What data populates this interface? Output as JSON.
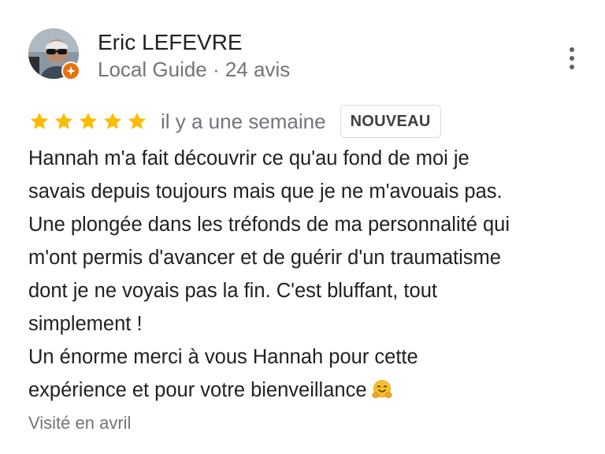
{
  "reviewer": {
    "name": "Eric LEFEVRE",
    "subtitle": "Local Guide · 24 avis",
    "avatar_icon": "profile-photo",
    "badge_icon": "local-guide-star-icon"
  },
  "menu": {
    "icon": "more-vert-icon"
  },
  "rating": {
    "stars": 5,
    "max_stars": 5,
    "star_color": "#fbbc04",
    "time_ago": "il y a une semaine",
    "badge": "NOUVEAU"
  },
  "review": {
    "lines": [
      "Hannah m'a fait découvrir ce qu'au fond de moi je",
      "savais depuis toujours mais que je ne m'avouais pas.",
      "Une plongée dans les tréfonds de ma personnalité qui",
      "m'ont permis d'avancer et de guérir d'un traumatisme",
      "dont je ne voyais pas la fin. C'est bluffant, tout",
      "simplement !",
      "Un énorme merci à vous Hannah pour cette",
      "expérience et pour votre bienveillance"
    ],
    "emoji_icon": "hugging-face-emoji"
  },
  "visited": "Visité en avril"
}
